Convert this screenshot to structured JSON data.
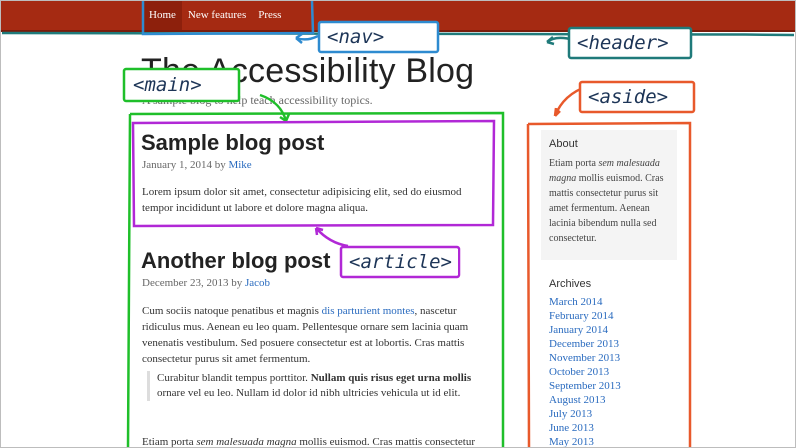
{
  "nav": {
    "items": [
      {
        "label": "Home"
      },
      {
        "label": "New features"
      },
      {
        "label": "Press"
      }
    ]
  },
  "blog": {
    "title": "The Accessibility Blog",
    "subtitle": "A sample blog to help teach accessibility topics."
  },
  "posts": [
    {
      "title": "Sample blog post",
      "date": "January 1, 2014",
      "by": "by",
      "author": "Mike",
      "body": "Lorem ipsum dolor sit amet, consectetur adipisicing elit, sed do eiusmod tempor incididunt ut labore et dolore magna aliqua."
    },
    {
      "title": "Another blog post",
      "date": "December 23, 2013",
      "by": "by",
      "author": "Jacob",
      "body_pre": "Cum sociis natoque penatibus et magnis ",
      "body_link": "dis parturient montes",
      "body_post": ", nascetur ridiculus mus. Aenean eu leo quam. Pellentesque ornare sem lacinia quam venenatis vestibulum. Sed posuere consectetur est at lobortis. Cras mattis consectetur purus sit amet fermentum.",
      "quote_pre": "Curabitur blandit tempus porttitor. ",
      "quote_bold": "Nullam quis risus eget urna mollis",
      "quote_post": " ornare vel eu leo. Nullam id dolor id nibh ultricies vehicula ut id elit.",
      "tail_pre": "Etiam porta ",
      "tail_em": "sem malesuada magna",
      "tail_post": " mollis euismod. Cras mattis consectetur"
    }
  ],
  "sidebar": {
    "about_heading": "About",
    "about_pre": "Etiam porta ",
    "about_em": "sem malesuada magna",
    "about_post": " mollis euismod. Cras mattis consectetur purus sit amet fermentum. Aenean lacinia bibendum nulla sed consectetur.",
    "archives_heading": "Archives",
    "archives": [
      "March 2014",
      "February 2014",
      "January 2014",
      "December 2013",
      "November 2013",
      "October 2013",
      "September 2013",
      "August 2013",
      "July 2013",
      "June 2013",
      "May 2013"
    ]
  },
  "annotations": {
    "nav": "<nav>",
    "header": "<header>",
    "main": "<main>",
    "aside": "<aside>",
    "article": "<article>"
  },
  "colors": {
    "topbar": "#a52a12",
    "nav_outline": "#2e8bd0",
    "header_outline": "#1f7a7a",
    "main_outline": "#1fbf2a",
    "aside_outline": "#e8592b",
    "article_outline": "#b128d6",
    "link": "#2a6bbf"
  }
}
